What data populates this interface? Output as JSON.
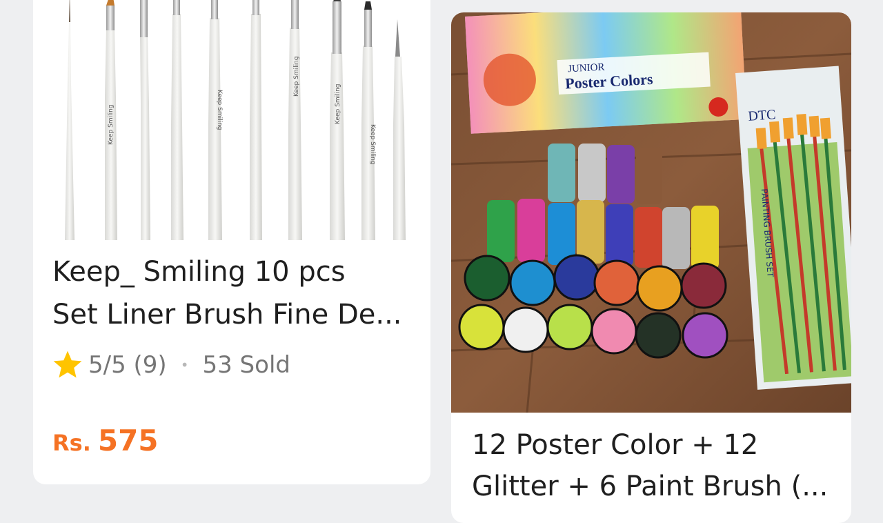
{
  "products": [
    {
      "title_line1": "Keep_ Smiling 10 pcs",
      "title_line2": "Set Liner Brush Fine De...",
      "rating": "5/5 (9)",
      "separator": "•",
      "sold": "53 Sold",
      "currency": "Rs.",
      "price": "575",
      "image_icon": "paint-brush-set-image",
      "brush_label": "Keep Smiling"
    },
    {
      "title_line1": "12 Poster Color + 12",
      "title_line2": "Glitter + 6 Paint Brush (...",
      "image_icon": "poster-colors-glitter-brushes-image",
      "box_brand": "Poster Colors",
      "box_sub": "JUNIOR",
      "pack_label": "PAINTING BRUSH SET",
      "pack_brand": "DTC"
    }
  ],
  "colors": {
    "price_orange": "#f57224",
    "star_yellow": "#ffc400",
    "text_primary": "#1f1f1f",
    "text_secondary": "#757575",
    "background": "#eeeff1"
  }
}
